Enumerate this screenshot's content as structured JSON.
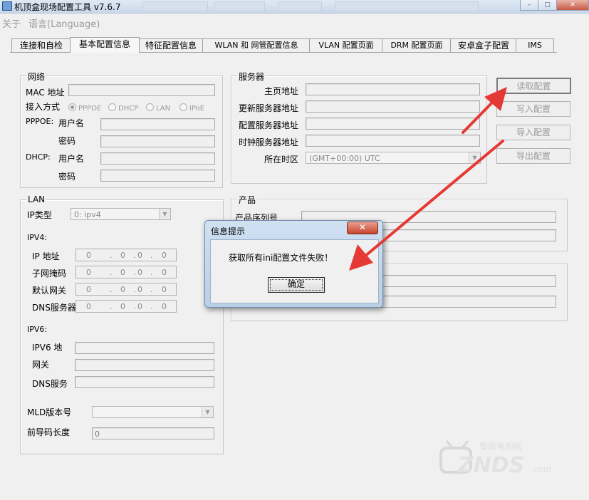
{
  "window": {
    "title": "机顶盒现场配置工具 v7.6.7",
    "controls": {
      "minimize": "–",
      "maximize": "□",
      "close": "✕"
    }
  },
  "menu": {
    "about": "关于",
    "language": "语言(Language)"
  },
  "tabs": [
    "连接和自检",
    "基本配置信息",
    "特征配置信息",
    "WLAN 和 网管配置信息",
    "VLAN 配置页面",
    "DRM 配置页面",
    "安卓盒子配置",
    "IMS"
  ],
  "network": {
    "legend": "网络",
    "mac_label": "MAC 地址",
    "access_label": "接入方式",
    "access_options": [
      "PPPOE",
      "DHCP",
      "LAN",
      "IPoE"
    ],
    "pppoe_label": "PPPOE:",
    "dhcp_label": "DHCP:",
    "username_label": "用户名",
    "password_label": "密码"
  },
  "server": {
    "legend": "服务器",
    "home_label": "主页地址",
    "update_label": "更新服务器地址",
    "config_label": "配置服务器地址",
    "clock_label": "时钟服务器地址",
    "timezone_label": "所在时区",
    "timezone_value": "(GMT+00:00) UTC"
  },
  "buttons": {
    "read": "读取配置",
    "write": "写入配置",
    "import": "导入配置",
    "export": "导出配置"
  },
  "lan": {
    "legend": "LAN",
    "ip_type_label": "IP类型",
    "ip_type_value": "0: ipv4",
    "ipv4_label": "IPV4:",
    "ip_label": "IP 地址",
    "mask_label": "子网掩码",
    "gateway_label": "默认网关",
    "dns_label": "DNS服务器",
    "ip_octets": [
      "0",
      "0",
      "0",
      "0"
    ],
    "ipv6_label": "IPV6:",
    "ipv6_addr_label": "IPV6 地",
    "ipv6_gateway_label": "网关",
    "ipv6_dns_label": "DNS服务",
    "mld_label": "MLD版本号",
    "prefix_label": "前导码长度",
    "prefix_value": "0"
  },
  "product": {
    "legend": "产品",
    "serial_label": "产品序列号"
  },
  "dialog": {
    "title": "信息提示",
    "close": "✕",
    "message": "获取所有ini配置文件失败！",
    "ok": "确定"
  },
  "watermark": {
    "small": "智能电视网",
    "big": "ZNDS",
    "suffix": ".com"
  },
  "colors": {
    "annotation_arrow": "#e53935",
    "dialog_close": "#c8442c",
    "titlebar": "#c9d8ea"
  }
}
